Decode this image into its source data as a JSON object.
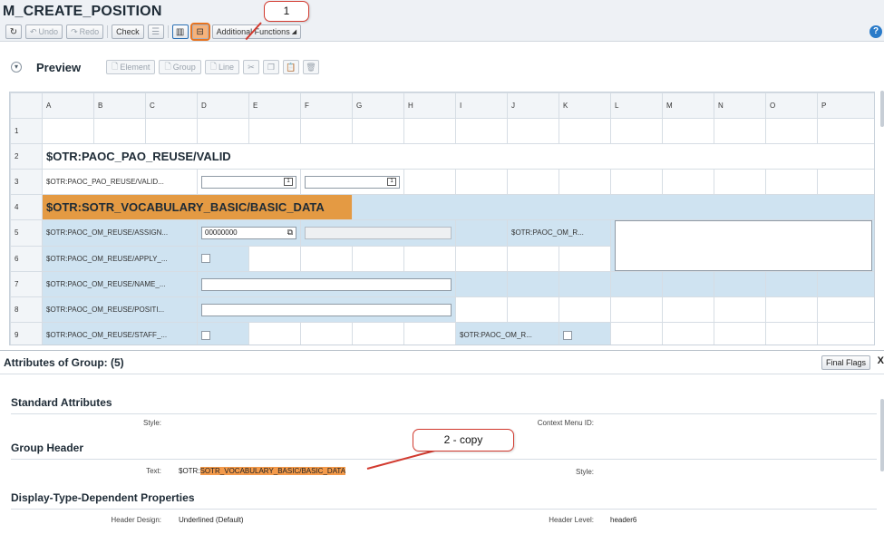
{
  "title": "M_CREATE_POSITION",
  "toolbar": {
    "refresh": "↻",
    "undo": "Undo",
    "redo": "Redo",
    "check": "Check",
    "additional_functions": "Additional Functions"
  },
  "help": "?",
  "callouts": {
    "first": "1",
    "second": "2 - copy"
  },
  "preview": {
    "title": "Preview",
    "tools": {
      "element": "Element",
      "group": "Group",
      "line": "Line"
    }
  },
  "grid": {
    "columns": [
      "A",
      "B",
      "C",
      "D",
      "E",
      "F",
      "G",
      "H",
      "I",
      "J",
      "K",
      "L",
      "M",
      "N",
      "O",
      "P"
    ],
    "rows": {
      "r1": "1",
      "r2": "2",
      "r2_text": "$OTR:PAOC_PAO_REUSE/VALID",
      "r3": "3",
      "r3_label": "$OTR:PAOC_PAO_REUSE/VALID...",
      "r4": "4",
      "r4_text": "$OTR:SOTR_VOCABULARY_BASIC/BASIC_DATA",
      "r5": "5",
      "r5_label": "$OTR:PAOC_OM_REUSE/ASSIGN...",
      "r5_input": "00000000",
      "r5_label2": "$OTR:PAOC_OM_R...",
      "r6": "6",
      "r6_label": "$OTR:PAOC_OM_REUSE/APPLY_...",
      "r7": "7",
      "r7_label": "$OTR:PAOC_OM_REUSE/NAME_...",
      "r8": "8",
      "r8_label": "$OTR:PAOC_OM_REUSE/POSITI...",
      "r9": "9",
      "r9_label": "$OTR:PAOC_OM_REUSE/STAFF_...",
      "r9_label2": "$OTR:PAOC_OM_R..."
    }
  },
  "attributes": {
    "title": "Attributes of Group: (5)",
    "final_flags": "Final Flags",
    "close": "X",
    "standard": {
      "title": "Standard Attributes",
      "style_label": "Style:",
      "context_menu_label": "Context Menu ID:"
    },
    "group_header": {
      "title": "Group Header",
      "text_label": "Text:",
      "text_prefix": "$OTR:",
      "text_value": "SOTR_VOCABULARY_BASIC/BASIC_DATA",
      "style_label": "Style:"
    },
    "display": {
      "title": "Display-Type-Dependent Properties",
      "header_design_label": "Header Design:",
      "header_design_value": "Underlined (Default)",
      "header_level_label": "Header Level:",
      "header_level_value": "header6"
    }
  },
  "colors": {
    "highlight": "#f39a4b",
    "callout": "#d23a2f",
    "grid_blue": "#cfe3f1"
  }
}
